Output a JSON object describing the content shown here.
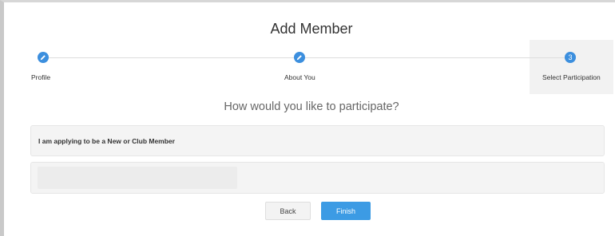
{
  "page": {
    "title": "Add Member"
  },
  "steps": [
    {
      "label": "Profile",
      "state": "complete",
      "icon": "pencil-icon"
    },
    {
      "label": "About You",
      "state": "complete",
      "icon": "pencil-icon"
    },
    {
      "label": "Select Participation",
      "state": "active",
      "number": "3"
    }
  ],
  "question": "How would you like to participate?",
  "options": [
    {
      "label": "I am applying to be a New or Club Member"
    },
    {
      "label": ""
    }
  ],
  "buttons": {
    "back": "Back",
    "finish": "Finish"
  },
  "colors": {
    "accent": "#3c8fde",
    "finish_button": "#3c9be4"
  }
}
